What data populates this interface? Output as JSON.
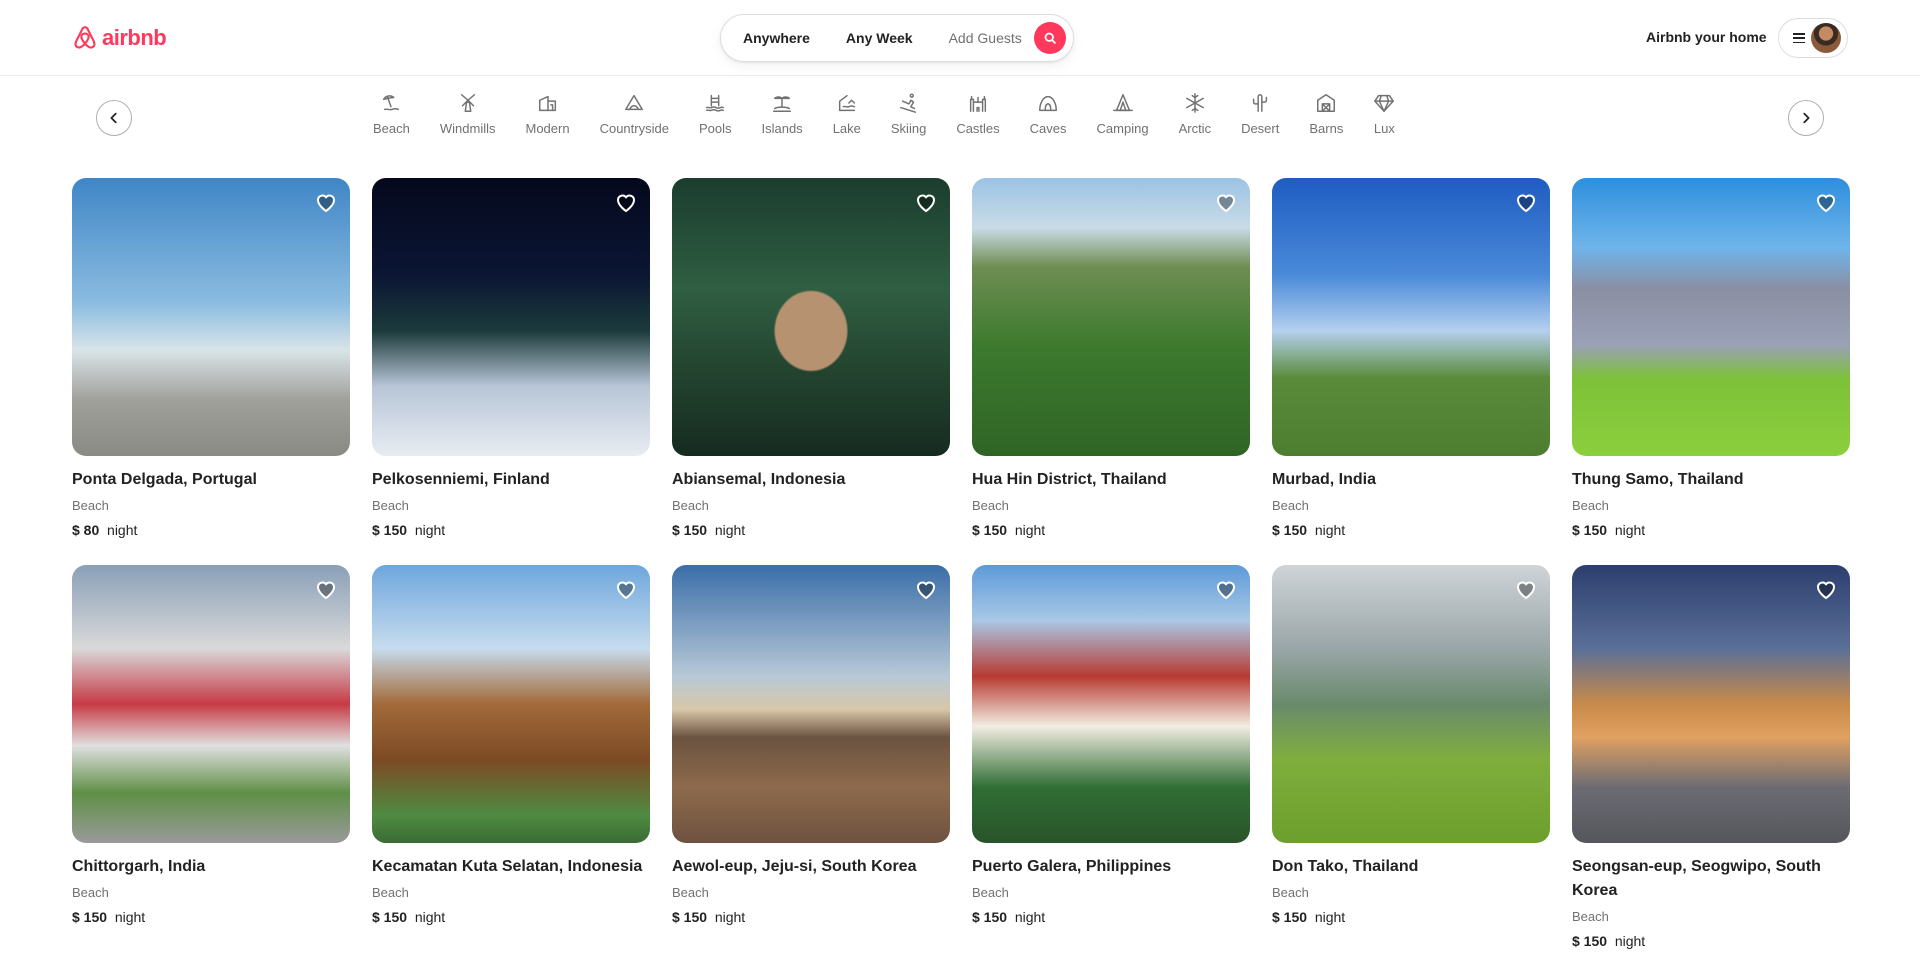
{
  "brand": {
    "name": "airbnb",
    "color": "#ff385c"
  },
  "search": {
    "anywhere": "Anywhere",
    "any_week": "Any Week",
    "add_guests": "Add Guests",
    "button_icon": "search-icon"
  },
  "header": {
    "host_link": "Airbnb your home",
    "menu_icon": "hamburger-icon"
  },
  "categories": [
    {
      "label": "Beach",
      "icon": "beach-icon"
    },
    {
      "label": "Windmills",
      "icon": "windmill-icon"
    },
    {
      "label": "Modern",
      "icon": "modern-house-icon"
    },
    {
      "label": "Countryside",
      "icon": "countryside-icon"
    },
    {
      "label": "Pools",
      "icon": "pool-icon"
    },
    {
      "label": "Islands",
      "icon": "island-icon"
    },
    {
      "label": "Lake",
      "icon": "lake-icon"
    },
    {
      "label": "Skiing",
      "icon": "skiing-icon"
    },
    {
      "label": "Castles",
      "icon": "castle-icon"
    },
    {
      "label": "Caves",
      "icon": "cave-icon"
    },
    {
      "label": "Camping",
      "icon": "camping-icon"
    },
    {
      "label": "Arctic",
      "icon": "snowflake-icon"
    },
    {
      "label": "Desert",
      "icon": "cactus-icon"
    },
    {
      "label": "Barns",
      "icon": "barn-icon"
    },
    {
      "label": "Lux",
      "icon": "diamond-icon"
    }
  ],
  "listings": [
    {
      "title": "Ponta Delgada, Portugal",
      "category": "Beach",
      "price": "$ 80",
      "unit": "night"
    },
    {
      "title": "Pelkosenniemi, Finland",
      "category": "Beach",
      "price": "$ 150",
      "unit": "night"
    },
    {
      "title": "Abiansemal, Indonesia",
      "category": "Beach",
      "price": "$ 150",
      "unit": "night"
    },
    {
      "title": "Hua Hin District, Thailand",
      "category": "Beach",
      "price": "$ 150",
      "unit": "night"
    },
    {
      "title": "Murbad, India",
      "category": "Beach",
      "price": "$ 150",
      "unit": "night"
    },
    {
      "title": "Thung Samo, Thailand",
      "category": "Beach",
      "price": "$ 150",
      "unit": "night"
    },
    {
      "title": "Chittorgarh, India",
      "category": "Beach",
      "price": "$ 150",
      "unit": "night"
    },
    {
      "title": "Kecamatan Kuta Selatan, Indonesia",
      "category": "Beach",
      "price": "$ 150",
      "unit": "night"
    },
    {
      "title": "Aewol-eup, Jeju-si, South Korea",
      "category": "Beach",
      "price": "$ 150",
      "unit": "night"
    },
    {
      "title": "Puerto Galera, Philippines",
      "category": "Beach",
      "price": "$ 150",
      "unit": "night"
    },
    {
      "title": "Don Tako, Thailand",
      "category": "Beach",
      "price": "$ 150",
      "unit": "night"
    },
    {
      "title": "Seongsan-eup, Seogwipo, South Korea",
      "category": "Beach",
      "price": "$ 150",
      "unit": "night"
    }
  ]
}
